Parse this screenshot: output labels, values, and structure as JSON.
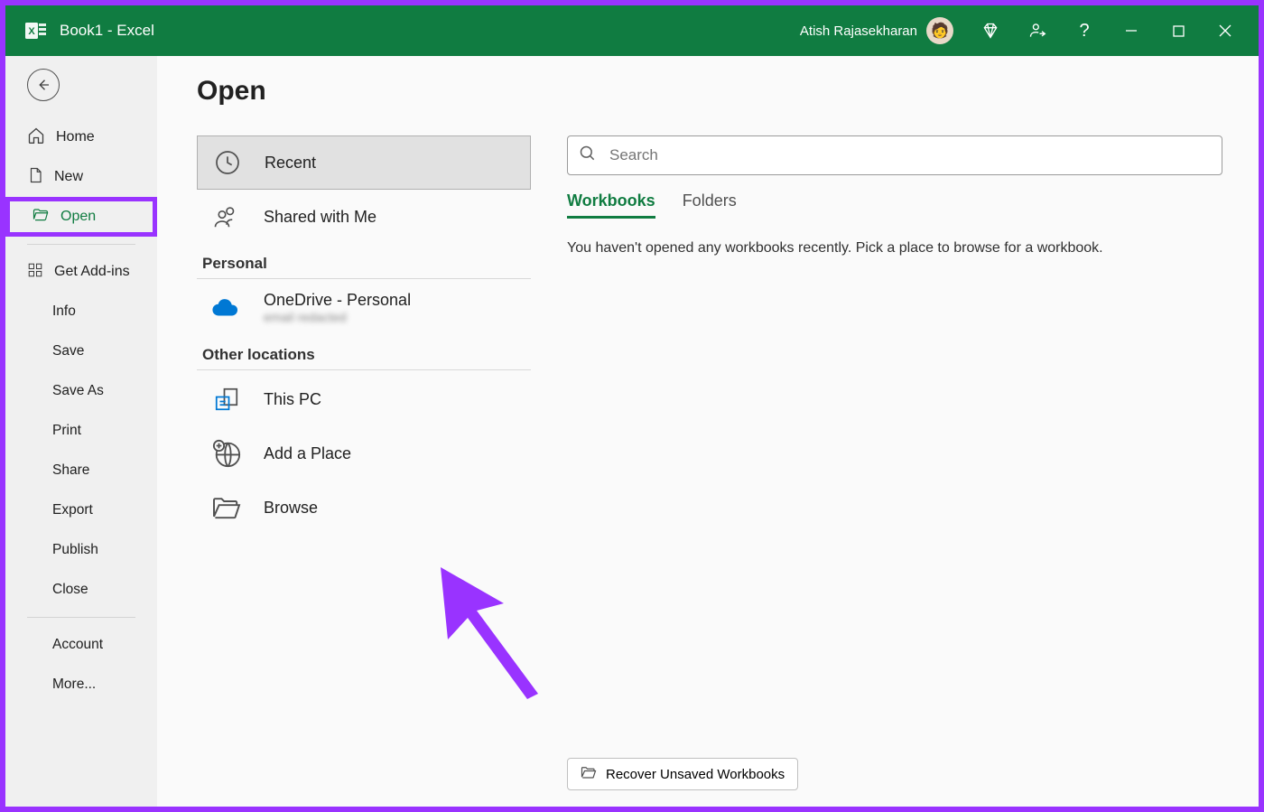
{
  "titlebar": {
    "title": "Book1  -  Excel",
    "user_name": "Atish Rajasekharan"
  },
  "sidebar": {
    "home": "Home",
    "new": "New",
    "open": "Open",
    "get_addins": "Get Add-ins",
    "info": "Info",
    "save": "Save",
    "save_as": "Save As",
    "print": "Print",
    "share": "Share",
    "export": "Export",
    "publish": "Publish",
    "close": "Close",
    "account": "Account",
    "more": "More..."
  },
  "page_title": "Open",
  "locations": {
    "recent": "Recent",
    "shared_with_me": "Shared with Me",
    "section_personal": "Personal",
    "onedrive": "OneDrive - Personal",
    "onedrive_sub": "email redacted",
    "section_other": "Other locations",
    "this_pc": "This PC",
    "add_place": "Add a Place",
    "browse": "Browse"
  },
  "search": {
    "placeholder": "Search"
  },
  "tabs": {
    "workbooks": "Workbooks",
    "folders": "Folders"
  },
  "empty_message": "You haven't opened any workbooks recently. Pick a place to browse for a workbook.",
  "recover_label": "Recover Unsaved Workbooks"
}
